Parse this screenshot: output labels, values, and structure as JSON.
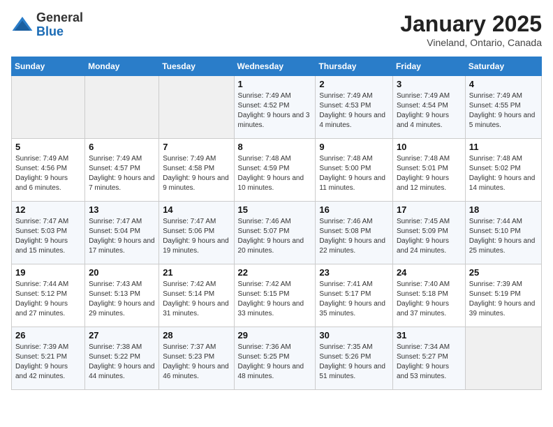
{
  "logo": {
    "line1": "General",
    "line2": "Blue"
  },
  "title": "January 2025",
  "location": "Vineland, Ontario, Canada",
  "days_of_week": [
    "Sunday",
    "Monday",
    "Tuesday",
    "Wednesday",
    "Thursday",
    "Friday",
    "Saturday"
  ],
  "weeks": [
    [
      {
        "day": "",
        "info": ""
      },
      {
        "day": "",
        "info": ""
      },
      {
        "day": "",
        "info": ""
      },
      {
        "day": "1",
        "info": "Sunrise: 7:49 AM\nSunset: 4:52 PM\nDaylight: 9 hours and 3 minutes."
      },
      {
        "day": "2",
        "info": "Sunrise: 7:49 AM\nSunset: 4:53 PM\nDaylight: 9 hours and 4 minutes."
      },
      {
        "day": "3",
        "info": "Sunrise: 7:49 AM\nSunset: 4:54 PM\nDaylight: 9 hours and 4 minutes."
      },
      {
        "day": "4",
        "info": "Sunrise: 7:49 AM\nSunset: 4:55 PM\nDaylight: 9 hours and 5 minutes."
      }
    ],
    [
      {
        "day": "5",
        "info": "Sunrise: 7:49 AM\nSunset: 4:56 PM\nDaylight: 9 hours and 6 minutes."
      },
      {
        "day": "6",
        "info": "Sunrise: 7:49 AM\nSunset: 4:57 PM\nDaylight: 9 hours and 7 minutes."
      },
      {
        "day": "7",
        "info": "Sunrise: 7:49 AM\nSunset: 4:58 PM\nDaylight: 9 hours and 9 minutes."
      },
      {
        "day": "8",
        "info": "Sunrise: 7:48 AM\nSunset: 4:59 PM\nDaylight: 9 hours and 10 minutes."
      },
      {
        "day": "9",
        "info": "Sunrise: 7:48 AM\nSunset: 5:00 PM\nDaylight: 9 hours and 11 minutes."
      },
      {
        "day": "10",
        "info": "Sunrise: 7:48 AM\nSunset: 5:01 PM\nDaylight: 9 hours and 12 minutes."
      },
      {
        "day": "11",
        "info": "Sunrise: 7:48 AM\nSunset: 5:02 PM\nDaylight: 9 hours and 14 minutes."
      }
    ],
    [
      {
        "day": "12",
        "info": "Sunrise: 7:47 AM\nSunset: 5:03 PM\nDaylight: 9 hours and 15 minutes."
      },
      {
        "day": "13",
        "info": "Sunrise: 7:47 AM\nSunset: 5:04 PM\nDaylight: 9 hours and 17 minutes."
      },
      {
        "day": "14",
        "info": "Sunrise: 7:47 AM\nSunset: 5:06 PM\nDaylight: 9 hours and 19 minutes."
      },
      {
        "day": "15",
        "info": "Sunrise: 7:46 AM\nSunset: 5:07 PM\nDaylight: 9 hours and 20 minutes."
      },
      {
        "day": "16",
        "info": "Sunrise: 7:46 AM\nSunset: 5:08 PM\nDaylight: 9 hours and 22 minutes."
      },
      {
        "day": "17",
        "info": "Sunrise: 7:45 AM\nSunset: 5:09 PM\nDaylight: 9 hours and 24 minutes."
      },
      {
        "day": "18",
        "info": "Sunrise: 7:44 AM\nSunset: 5:10 PM\nDaylight: 9 hours and 25 minutes."
      }
    ],
    [
      {
        "day": "19",
        "info": "Sunrise: 7:44 AM\nSunset: 5:12 PM\nDaylight: 9 hours and 27 minutes."
      },
      {
        "day": "20",
        "info": "Sunrise: 7:43 AM\nSunset: 5:13 PM\nDaylight: 9 hours and 29 minutes."
      },
      {
        "day": "21",
        "info": "Sunrise: 7:42 AM\nSunset: 5:14 PM\nDaylight: 9 hours and 31 minutes."
      },
      {
        "day": "22",
        "info": "Sunrise: 7:42 AM\nSunset: 5:15 PM\nDaylight: 9 hours and 33 minutes."
      },
      {
        "day": "23",
        "info": "Sunrise: 7:41 AM\nSunset: 5:17 PM\nDaylight: 9 hours and 35 minutes."
      },
      {
        "day": "24",
        "info": "Sunrise: 7:40 AM\nSunset: 5:18 PM\nDaylight: 9 hours and 37 minutes."
      },
      {
        "day": "25",
        "info": "Sunrise: 7:39 AM\nSunset: 5:19 PM\nDaylight: 9 hours and 39 minutes."
      }
    ],
    [
      {
        "day": "26",
        "info": "Sunrise: 7:39 AM\nSunset: 5:21 PM\nDaylight: 9 hours and 42 minutes."
      },
      {
        "day": "27",
        "info": "Sunrise: 7:38 AM\nSunset: 5:22 PM\nDaylight: 9 hours and 44 minutes."
      },
      {
        "day": "28",
        "info": "Sunrise: 7:37 AM\nSunset: 5:23 PM\nDaylight: 9 hours and 46 minutes."
      },
      {
        "day": "29",
        "info": "Sunrise: 7:36 AM\nSunset: 5:25 PM\nDaylight: 9 hours and 48 minutes."
      },
      {
        "day": "30",
        "info": "Sunrise: 7:35 AM\nSunset: 5:26 PM\nDaylight: 9 hours and 51 minutes."
      },
      {
        "day": "31",
        "info": "Sunrise: 7:34 AM\nSunset: 5:27 PM\nDaylight: 9 hours and 53 minutes."
      },
      {
        "day": "",
        "info": ""
      }
    ]
  ]
}
